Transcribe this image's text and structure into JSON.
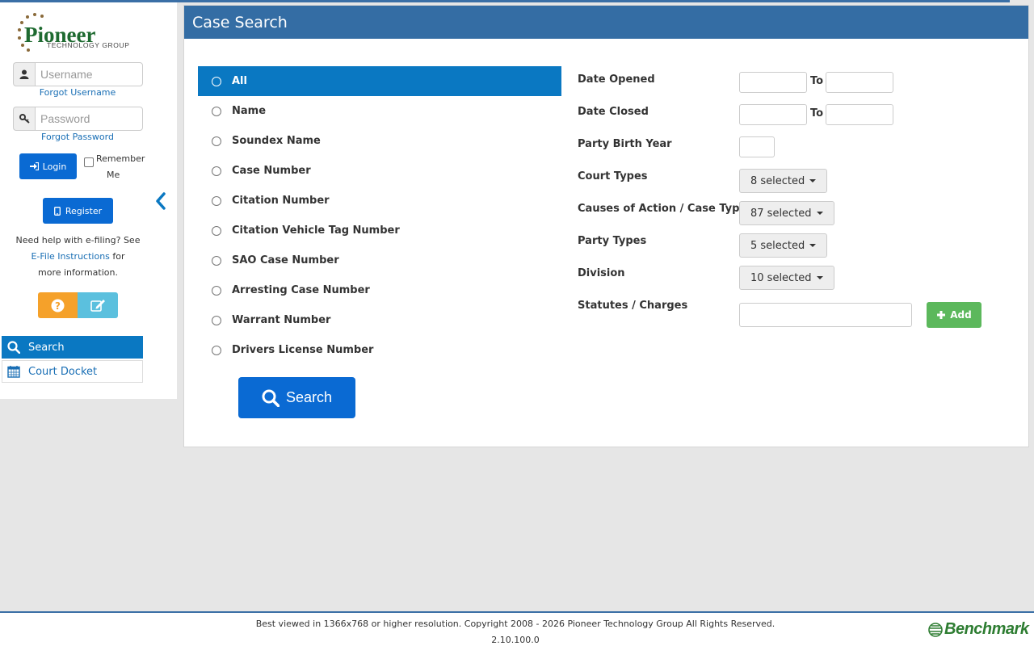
{
  "app": {
    "brand": "Pioneer",
    "brand_sub": "TECHNOLOGY GROUP"
  },
  "sidebar": {
    "username_placeholder": "Username",
    "forgot_username": "Forgot Username",
    "password_placeholder": "Password",
    "forgot_password": "Forgot Password",
    "login_label": "Login",
    "remember_line1": "Remember",
    "remember_line2": "Me",
    "register_label": "Register",
    "help_line1": "Need help with e-filing? See",
    "help_link": "E-File Instructions",
    "help_line2_tail": "for",
    "help_line3": "more information.",
    "nav": [
      {
        "label": "Search",
        "icon": "search-icon"
      },
      {
        "label": "Court Docket",
        "icon": "calendar-icon"
      }
    ]
  },
  "main": {
    "title": "Case Search",
    "search_options": [
      "All",
      "Name",
      "Soundex Name",
      "Case Number",
      "Citation Number",
      "Citation Vehicle Tag Number",
      "SAO Case Number",
      "Arresting Case Number",
      "Warrant Number",
      "Drivers License Number"
    ],
    "selected_option": "All",
    "search_button": "Search",
    "filters": {
      "date_opened": "Date Opened",
      "date_closed": "Date Closed",
      "to_label": "To",
      "party_birth_year": "Party Birth Year",
      "court_types": {
        "label": "Court Types",
        "value": "8 selected"
      },
      "causes": {
        "label": "Causes of Action / Case Types",
        "value": "87 selected"
      },
      "party_types": {
        "label": "Party Types",
        "value": "5 selected"
      },
      "division": {
        "label": "Division",
        "value": "10 selected"
      },
      "statutes": "Statutes / Charges",
      "add_button": "Add"
    }
  },
  "footer": {
    "line1": "Best viewed in 1366x768 or higher resolution. Copyright 2008 - 2026 Pioneer Technology Group All Rights Reserved.",
    "version": "2.10.100.0",
    "logo_text": "Benchmark"
  },
  "colors": {
    "header": "#346da4",
    "accent": "#0a78c2",
    "button": "#0a6ad3",
    "add": "#5cb85c"
  }
}
